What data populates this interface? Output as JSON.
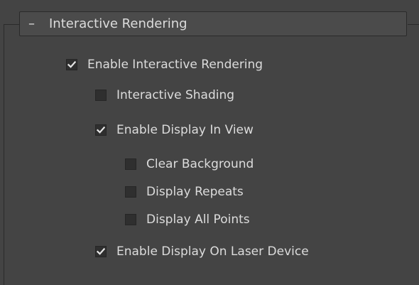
{
  "rollout": {
    "toggle_symbol": "–",
    "title": "Interactive Rendering"
  },
  "options": {
    "enable_interactive_rendering": {
      "label": "Enable Interactive Rendering",
      "checked": true
    },
    "interactive_shading": {
      "label": "Interactive Shading",
      "checked": false
    },
    "enable_display_in_view": {
      "label": "Enable Display In View",
      "checked": true
    },
    "clear_background": {
      "label": "Clear Background",
      "checked": false
    },
    "display_repeats": {
      "label": "Display Repeats",
      "checked": false
    },
    "display_all_points": {
      "label": "Display All Points",
      "checked": false
    },
    "enable_display_on_laser_device": {
      "label": "Enable Display On Laser Device",
      "checked": true
    }
  },
  "colors": {
    "background": "#444444",
    "text": "#dcdcdc",
    "checkbox_fill": "#2f2f2f",
    "checkmark": "#e6e6e6"
  },
  "icons": {
    "checkmark": "checkmark-icon"
  }
}
